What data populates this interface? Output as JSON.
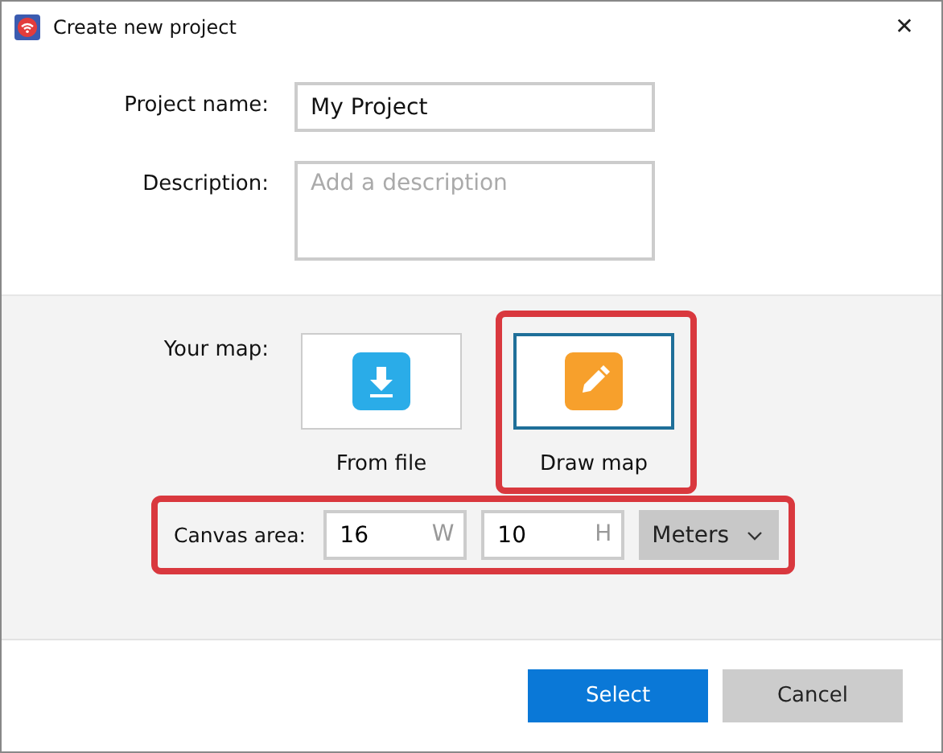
{
  "window": {
    "title": "Create new project",
    "close": "✕"
  },
  "fields": [
    {
      "label": "Project name:",
      "value": "My Project",
      "kind": "single"
    },
    {
      "label": "Description:",
      "placeholder": "Add a description",
      "kind": "multi"
    }
  ],
  "map": {
    "label": "Your map:",
    "options": [
      {
        "label": "From file",
        "kind": "download",
        "selected": false,
        "highlighted": false
      },
      {
        "label": "Draw map",
        "kind": "pencil",
        "selected": true,
        "highlighted": true
      }
    ]
  },
  "canvas_area": {
    "label": "Canvas area:",
    "highlighted": true,
    "width": {
      "value": "16",
      "unit": "W"
    },
    "height": {
      "value": "10",
      "unit": "H"
    },
    "units": "Meters"
  },
  "buttons": [
    {
      "label": "Select",
      "kind": "primary"
    },
    {
      "label": "Cancel",
      "kind": "secondary"
    }
  ]
}
